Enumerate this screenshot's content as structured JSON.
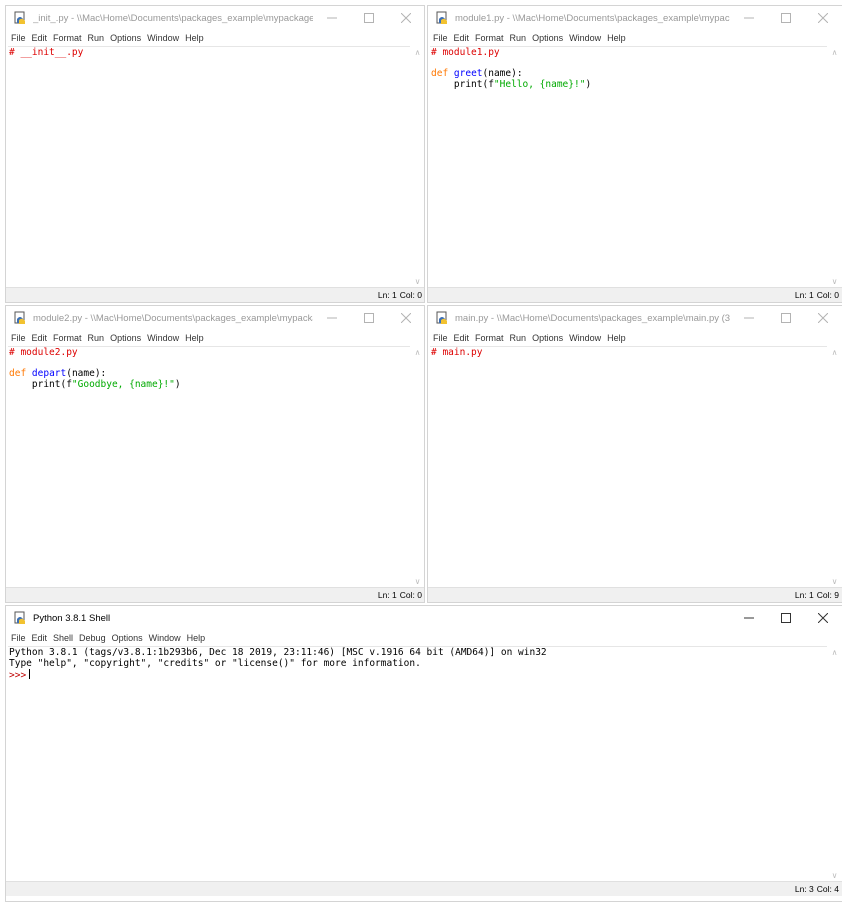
{
  "menus": {
    "editor": [
      "File",
      "Edit",
      "Format",
      "Run",
      "Options",
      "Window",
      "Help"
    ],
    "shell": [
      "File",
      "Edit",
      "Shell",
      "Debug",
      "Options",
      "Window",
      "Help"
    ]
  },
  "colors": {
    "comment": "#dd0000",
    "keyword": "#ff7700",
    "definition": "#0000ff",
    "string": "#00aa00",
    "prompt": "#c00000"
  },
  "icons": {
    "app": "python-idle-icon",
    "minimize": "minimize-icon",
    "maximize": "maximize-icon",
    "close": "close-icon",
    "scroll_up": "scroll-up-arrow-icon",
    "scroll_down": "scroll-down-arrow-icon"
  },
  "windows": {
    "init": {
      "title": "_init_.py - \\\\Mac\\Home\\Documents\\packages_example\\mypackage\\...",
      "code_comment": "# __init__.py",
      "status_ln": "Ln: 1",
      "status_col": "Col: 0"
    },
    "module1": {
      "title": "module1.py - \\\\Mac\\Home\\Documents\\packages_example\\mypacka...",
      "code_comment": "# module1.py",
      "def_keyword": "def",
      "func_name": "greet",
      "func_args": "(name):",
      "print_call": "    print(f",
      "string": "\"Hello, {name}!\"",
      "close_paren": ")",
      "status_ln": "Ln: 1",
      "status_col": "Col: 0"
    },
    "module2": {
      "title": "module2.py - \\\\Mac\\Home\\Documents\\packages_example\\mypacka...",
      "code_comment": "# module2.py",
      "def_keyword": "def",
      "func_name": "depart",
      "func_args": "(name):",
      "print_call": "    print(f",
      "string": "\"Goodbye, {name}!\"",
      "close_paren": ")",
      "status_ln": "Ln: 1",
      "status_col": "Col: 0"
    },
    "main": {
      "title": "main.py - \\\\Mac\\Home\\Documents\\packages_example\\main.py (3.8.1)",
      "code_comment": "# main.py",
      "status_ln": "Ln: 1",
      "status_col": "Col: 9"
    },
    "shell": {
      "title": "Python 3.8.1 Shell",
      "banner_line1": "Python 3.8.1 (tags/v3.8.1:1b293b6, Dec 18 2019, 23:11:46) [MSC v.1916 64 bit (AMD64)] on win32",
      "banner_line2": "Type \"help\", \"copyright\", \"credits\" or \"license()\" for more information.",
      "prompt": ">>>",
      "status_ln": "Ln: 3",
      "status_col": "Col: 4"
    }
  }
}
